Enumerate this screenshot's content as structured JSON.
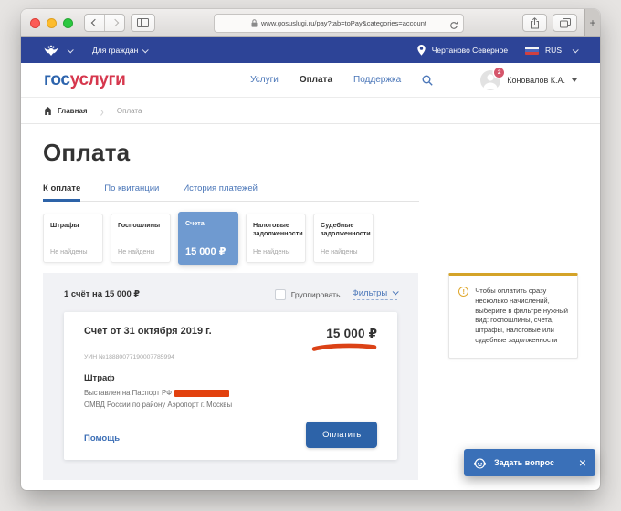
{
  "browser": {
    "url": "www.gosuslugi.ru/pay?tab=toPay&categories=account"
  },
  "topbar": {
    "audience": "Для граждан",
    "location": "Чертаново Северное",
    "lang": "RUS"
  },
  "header": {
    "logo_blue": "гос",
    "logo_red": "услуги",
    "nav": [
      {
        "label": "Услуги",
        "active": false
      },
      {
        "label": "Оплата",
        "active": true
      },
      {
        "label": "Поддержка",
        "active": false
      }
    ],
    "user": {
      "name": "Коновалов К.А.",
      "badge": "2"
    }
  },
  "breadcrumb": {
    "home": "Главная",
    "current": "Оплата"
  },
  "page": {
    "title": "Оплата",
    "tabs": [
      {
        "label": "К оплате",
        "active": true
      },
      {
        "label": "По квитанции",
        "active": false
      },
      {
        "label": "История платежей",
        "active": false
      }
    ],
    "categories": [
      {
        "title": "Штрафы",
        "value": "Не найдены",
        "selected": false
      },
      {
        "title": "Госпошлины",
        "value": "Не найдены",
        "selected": false
      },
      {
        "title": "Счета",
        "value": "15 000 ₽",
        "selected": true
      },
      {
        "title": "Налоговые задолженности",
        "value": "Не найдены",
        "selected": false
      },
      {
        "title": "Судебные задолженности",
        "value": "Не найдены",
        "selected": false
      }
    ]
  },
  "bills": {
    "summary": "1 счёт на 15 000 ₽",
    "group_label": "Группировать",
    "filters_label": "Фильтры",
    "card": {
      "title": "Счет от 31 октября 2019 г.",
      "uin": "УИН №18880077190007785994",
      "amount": "15 000 ₽",
      "type": "Штраф",
      "issued_to": "Выставлен на Паспорт РФ",
      "issuer": "ОМВД России по району Аэропорт г. Москвы",
      "help_label": "Помощь",
      "pay_label": "Оплатить"
    }
  },
  "info_box": {
    "text": "Чтобы оплатить сразу несколько начислений, выберите в фильтре нужный вид: госпошлины, счета, штрафы, налоговые или судебные задолженности"
  },
  "chat": {
    "label": "Задать вопрос"
  },
  "icons": {
    "new_tab": "+",
    "close": "×",
    "breadcrumb_sep": "›",
    "alert": "!"
  },
  "colors": {
    "gov_bar_blue": "#2d4497",
    "accent_blue": "#2d63a8",
    "link_blue": "#4a76b8",
    "logo_blue": "#2d64ad",
    "logo_red": "#d6374d",
    "selected_card_blue": "#6f9ad0",
    "info_accent_gold": "#d4a328",
    "marker_red": "#db4216",
    "redaction_red": "#e2410e",
    "chat_blue": "#3a70b8",
    "badge_red": "#d5566b"
  }
}
